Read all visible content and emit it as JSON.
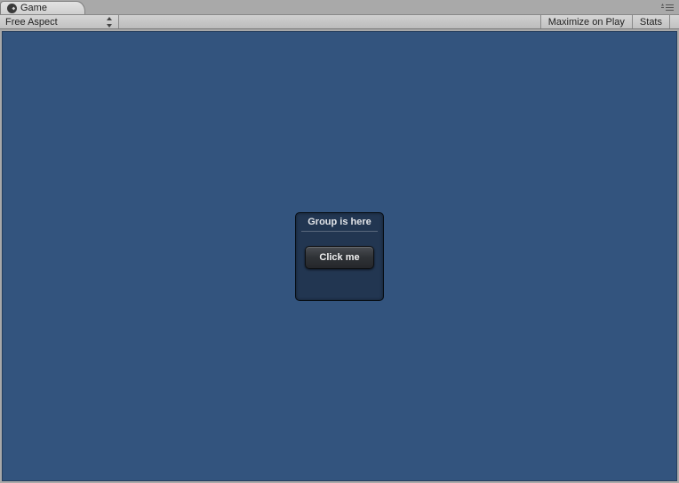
{
  "tab": {
    "title": "Game"
  },
  "toolbar": {
    "aspect_dropdown": {
      "selected": "Free Aspect"
    },
    "maximize_label": "Maximize on Play",
    "stats_label": "Stats"
  },
  "gui": {
    "group_title": "Group is here",
    "button_label": "Click me"
  }
}
